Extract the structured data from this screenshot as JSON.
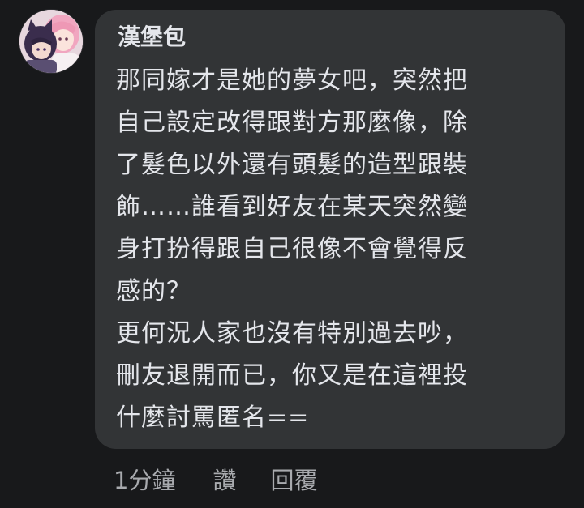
{
  "comment": {
    "author_name": "漢堡包",
    "avatar_icon": "anime-couple-avatar-icon",
    "lines": [
      "那同嫁才是她的夢女吧，突然把",
      "自己設定改得跟對方那麼像，除",
      "了髮色以外還有頭髮的造型跟裝",
      "飾……誰看到好友在某天突然變",
      "身打扮得跟自己很像不會覺得反",
      "感的？",
      "更何況人家也沒有特別過去吵，",
      "刪友退開而已，你又是在這裡投",
      "什麼討罵匿名=="
    ],
    "timestamp": "1分鐘",
    "like_label": "讚",
    "reply_label": "回覆"
  },
  "colors": {
    "background": "#18191b",
    "bubble": "#323436",
    "text": "#e4e6eb",
    "secondary_text": "#a8aaae"
  }
}
